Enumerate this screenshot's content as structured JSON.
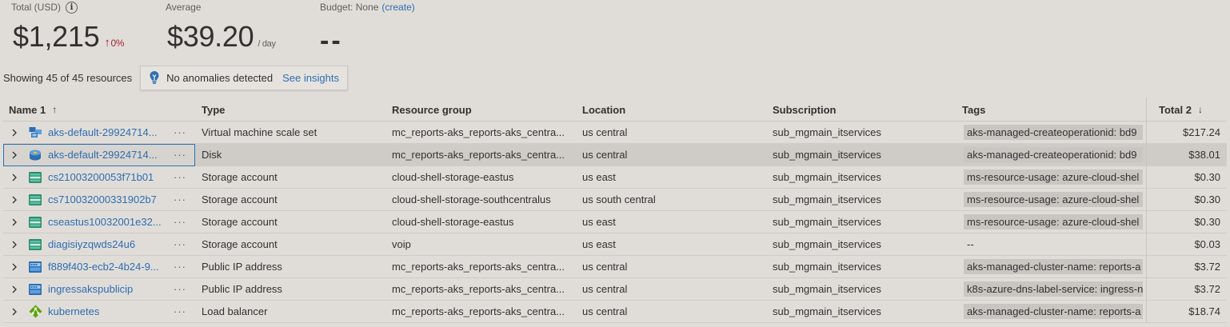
{
  "summary": {
    "total_label": "Total (USD)",
    "total_value": "$1,215",
    "total_trend": "0%",
    "average_label": "Average",
    "average_value": "$39.20",
    "average_unit": "/ day",
    "budget_label": "Budget: None",
    "budget_link": "(create)",
    "budget_value": "--"
  },
  "status": {
    "showing_text": "Showing 45 of 45 resources",
    "anomaly_text": "No anomalies detected",
    "insights_link": "See insights"
  },
  "columns": {
    "name": "Name 1",
    "type": "Type",
    "group": "Resource group",
    "location": "Location",
    "subscription": "Subscription",
    "tags": "Tags",
    "total": "Total 2"
  },
  "rows": [
    {
      "icon": "vmss-icon",
      "name": "aks-default-29924714...",
      "type": "Virtual machine scale set",
      "group": "mc_reports-aks_reports-aks_centra...",
      "location": "us central",
      "subscription": "sub_mgmain_itservices",
      "tags": "aks-managed-createoperationid: bd9",
      "total": "$217.24"
    },
    {
      "icon": "disk-icon",
      "name": "aks-default-29924714...",
      "type": "Disk",
      "group": "mc_reports-aks_reports-aks_centra...",
      "location": "us central",
      "subscription": "sub_mgmain_itservices",
      "tags": "aks-managed-createoperationid: bd9",
      "total": "$38.01"
    },
    {
      "icon": "storage-icon",
      "name": "cs21003200053f71b01",
      "type": "Storage account",
      "group": "cloud-shell-storage-eastus",
      "location": "us east",
      "subscription": "sub_mgmain_itservices",
      "tags": "ms-resource-usage: azure-cloud-shel",
      "total": "$0.30"
    },
    {
      "icon": "storage-icon",
      "name": "cs710032000331902b7",
      "type": "Storage account",
      "group": "cloud-shell-storage-southcentralus",
      "location": "us south central",
      "subscription": "sub_mgmain_itservices",
      "tags": "ms-resource-usage: azure-cloud-shel",
      "total": "$0.30"
    },
    {
      "icon": "storage-icon",
      "name": "cseastus10032001e32...",
      "type": "Storage account",
      "group": "cloud-shell-storage-eastus",
      "location": "us east",
      "subscription": "sub_mgmain_itservices",
      "tags": "ms-resource-usage: azure-cloud-shel",
      "total": "$0.30"
    },
    {
      "icon": "storage-icon",
      "name": "diagisiyzqwds24u6",
      "type": "Storage account",
      "group": "voip",
      "location": "us east",
      "subscription": "sub_mgmain_itservices",
      "tags": "--",
      "total": "$0.03"
    },
    {
      "icon": "public-ip-icon",
      "name": "f889f403-ecb2-4b24-9...",
      "type": "Public IP address",
      "group": "mc_reports-aks_reports-aks_centra...",
      "location": "us central",
      "subscription": "sub_mgmain_itservices",
      "tags": "aks-managed-cluster-name: reports-a",
      "total": "$3.72"
    },
    {
      "icon": "public-ip-icon",
      "name": "ingressakspublicip",
      "type": "Public IP address",
      "group": "mc_reports-aks_reports-aks_centra...",
      "location": "us central",
      "subscription": "sub_mgmain_itservices",
      "tags": "k8s-azure-dns-label-service: ingress-n",
      "total": "$3.72"
    },
    {
      "icon": "load-balancer-icon",
      "name": "kubernetes",
      "type": "Load balancer",
      "group": "mc_reports-aks_reports-aks_centra...",
      "location": "us central",
      "subscription": "sub_mgmain_itservices",
      "tags": "aks-managed-cluster-name: reports-a",
      "total": "$18.74"
    }
  ]
}
